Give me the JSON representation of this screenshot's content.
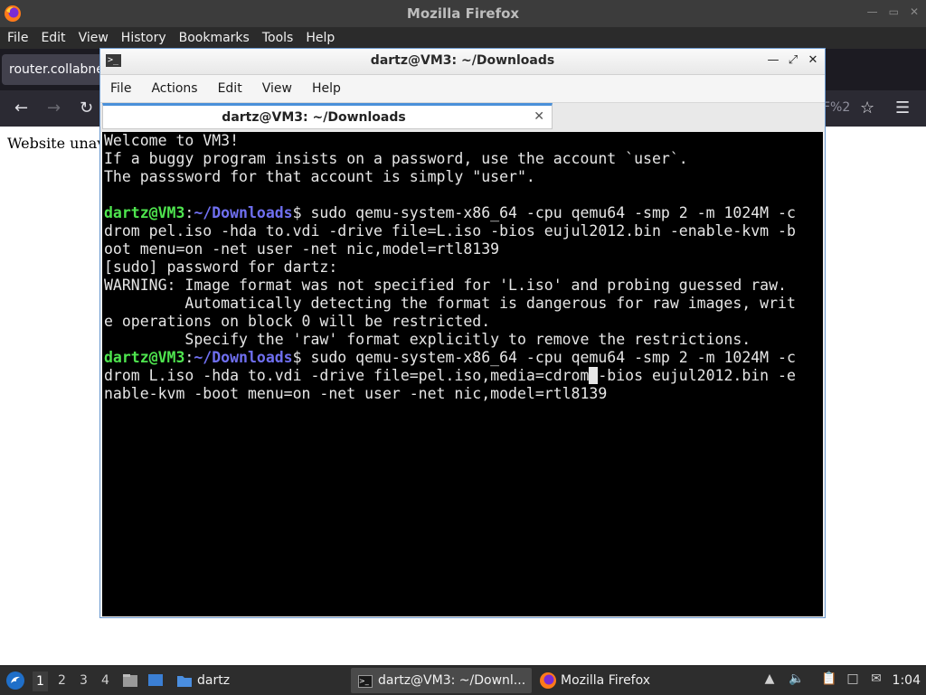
{
  "firefox": {
    "title": "Mozilla Firefox",
    "menu": [
      "File",
      "Edit",
      "View",
      "History",
      "Bookmarks",
      "Tools",
      "Help"
    ],
    "tab_label": "router.collabnet",
    "url_fragment": "F%2",
    "page_text": "Website unav"
  },
  "terminal": {
    "title": "dartz@VM3: ~/Downloads",
    "menu": [
      "File",
      "Actions",
      "Edit",
      "View",
      "Help"
    ],
    "tab_label": "dartz@VM3: ~/Downloads",
    "prompt_user": "dartz@VM3",
    "prompt_path": "~/Downloads",
    "lines": {
      "l1": "Welcome to VM3!",
      "l2": "If a buggy program insists on a password, use the account `user`.",
      "l3": "The passsword for that account is simply \"user\".",
      "cmd1_a": "$ sudo qemu-system-x86_64 -cpu qemu64 -smp 2 -m 1024M -c",
      "cmd1_b": "drom pel.iso -hda to.vdi -drive file=L.iso -bios eujul2012.bin -enable-kvm -b",
      "cmd1_c": "oot menu=on -net user -net nic,model=rtl8139",
      "sudo": "[sudo] password for dartz:",
      "warn1": "WARNING: Image format was not specified for 'L.iso' and probing guessed raw.",
      "warn2": "         Automatically detecting the format is dangerous for raw images, writ",
      "warn3": "e operations on block 0 will be restricted.",
      "warn4": "         Specify the 'raw' format explicitly to remove the restrictions.",
      "cmd2_a": "$ sudo qemu-system-x86_64 -cpu qemu64 -smp 2 -m 1024M -c",
      "cmd2_b_pre": "drom L.iso -hda to.vdi -drive file=pel.iso,media=cdrom",
      "cmd2_b_cursor": " ",
      "cmd2_b_post": "-bios eujul2012.bin -e",
      "cmd2_c": "nable-kvm -boot menu=on -net user -net nic,model=rtl8139"
    }
  },
  "taskbar": {
    "workspaces": [
      "1",
      "2",
      "3",
      "4"
    ],
    "folder_label": "dartz",
    "task_terminal": "dartz@VM3: ~/Downl...",
    "task_firefox": "Mozilla Firefox",
    "clock": "1:04"
  }
}
